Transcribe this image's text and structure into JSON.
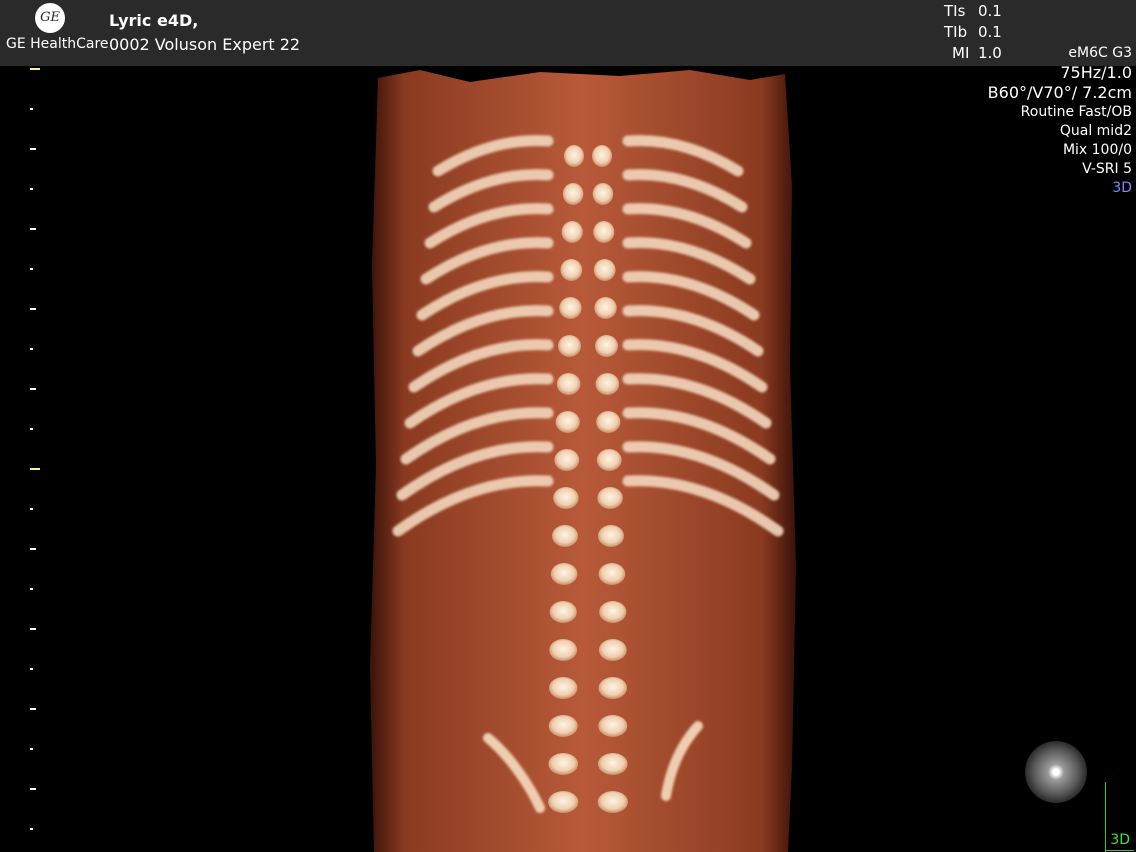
{
  "header": {
    "brand": "GE HealthCare",
    "logo_text": "GE",
    "study_name": "Lyric e4D,",
    "device": "0002 Voluson Expert 22",
    "indices": [
      {
        "label": "TIs",
        "value": "0.1"
      },
      {
        "label": "TIb",
        "value": "0.1"
      },
      {
        "label": "MI",
        "value": "1.0"
      }
    ]
  },
  "params": {
    "probe": "eM6C G3",
    "frame_rate": "75Hz/1.0",
    "angle_depth": "B60°/V70°/ 7.2cm",
    "preset": "Routine Fast/OB",
    "quality": "Qual mid2",
    "mix": "Mix 100/0",
    "vsri": "V-SRI 5",
    "mode": "3D"
  },
  "corner_mode": "3D",
  "colors": {
    "header_bg": "#2a2a2a",
    "mode_accent": "#7b88ff",
    "corner_label": "#40e040",
    "scale_highlight": "#ffeaa0",
    "render_tissue": "#a0492c",
    "render_bone": "#f4dcc4"
  },
  "icons": [
    "ge-logo-icon",
    "orientation-sphere-icon"
  ]
}
